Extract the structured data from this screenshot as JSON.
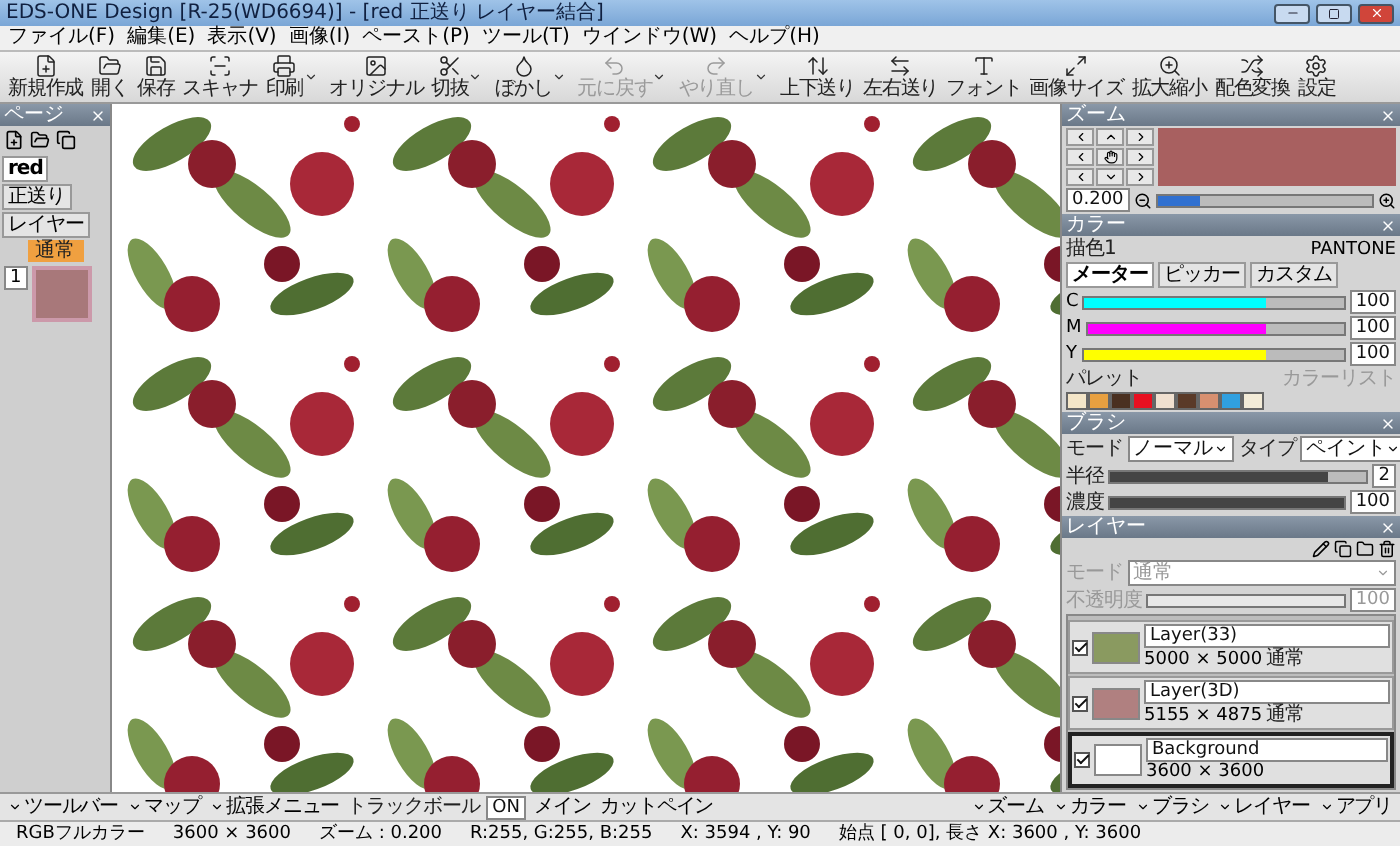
{
  "window": {
    "title": "EDS-ONE Design [R-25(WD6694)] - [red 正送り レイヤー結合]"
  },
  "menu": [
    "ファイル(F)",
    "編集(E)",
    "表示(V)",
    "画像(I)",
    "ペースト(P)",
    "ツール(T)",
    "ウインドウ(W)",
    "ヘルプ(H)"
  ],
  "toolbar": [
    {
      "label": "新規作成",
      "kind": "new",
      "disabled": false,
      "dropdown": false
    },
    {
      "label": "開く",
      "kind": "open",
      "disabled": false,
      "dropdown": false
    },
    {
      "label": "保存",
      "kind": "save",
      "disabled": false,
      "dropdown": false
    },
    {
      "label": "スキャナ",
      "kind": "scan",
      "disabled": false,
      "dropdown": false
    },
    {
      "label": "印刷",
      "kind": "print",
      "disabled": false,
      "dropdown": true
    },
    {
      "label": "オリジナル",
      "kind": "image",
      "disabled": false,
      "dropdown": false
    },
    {
      "label": "切抜",
      "kind": "cut",
      "disabled": false,
      "dropdown": true
    },
    {
      "label": "ぼかし",
      "kind": "blur",
      "disabled": false,
      "dropdown": true
    },
    {
      "label": "元に戻す",
      "kind": "undo",
      "disabled": true,
      "dropdown": true
    },
    {
      "label": "やり直し",
      "kind": "redo",
      "disabled": true,
      "dropdown": true
    },
    {
      "label": "上下送り",
      "kind": "vertical",
      "disabled": false,
      "dropdown": false
    },
    {
      "label": "左右送り",
      "kind": "horizontal",
      "disabled": false,
      "dropdown": false
    },
    {
      "label": "フォント",
      "kind": "font",
      "disabled": false,
      "dropdown": false
    },
    {
      "label": "画像サイズ",
      "kind": "size",
      "disabled": false,
      "dropdown": false
    },
    {
      "label": "拡大縮小",
      "kind": "scale",
      "disabled": false,
      "dropdown": false
    },
    {
      "label": "配色変換",
      "kind": "recolor",
      "disabled": false,
      "dropdown": false
    },
    {
      "label": "設定",
      "kind": "settings",
      "disabled": false,
      "dropdown": false
    }
  ],
  "left_panel": {
    "title": "ページ",
    "tabs": [
      {
        "label": "red",
        "selected": true
      },
      {
        "label": "正送り",
        "selected": false
      },
      {
        "label": "レイヤー",
        "selected": false
      }
    ],
    "page_label": "通常",
    "page_number": "1"
  },
  "zoom_panel": {
    "title": "ズーム",
    "value": "0.200",
    "level": 0.2
  },
  "color_panel": {
    "title": "カラー",
    "drawing_color": "描色1",
    "system": "PANTONE",
    "tabs": [
      {
        "label": "メーター",
        "selected": true
      },
      {
        "label": "ピッカー",
        "selected": false
      },
      {
        "label": "カスタム",
        "selected": false
      }
    ],
    "channels": [
      {
        "name": "C",
        "value": "100",
        "level": 0.7,
        "color": "#00ffff"
      },
      {
        "name": "M",
        "value": "100",
        "level": 0.7,
        "color": "#ff00ff"
      },
      {
        "name": "Y",
        "value": "100",
        "level": 0.7,
        "color": "#ffff00"
      }
    ],
    "palette_label": "パレット",
    "list_label": "カラーリスト",
    "swatches": [
      {
        "color": "#f5e6c8"
      },
      {
        "color": "#e8a040"
      },
      {
        "color": "#4a3020"
      },
      {
        "color": "#e81020"
      },
      {
        "color": "#f0e0d0"
      },
      {
        "color": "#5a3a28"
      },
      {
        "color": "#d89070"
      },
      {
        "color": "#30a0e0"
      },
      {
        "color": "#f4ecd8"
      }
    ]
  },
  "brush_panel": {
    "title": "ブラシ",
    "mode_label": "モード",
    "mode": "ノーマル",
    "type_label": "タイプ",
    "type": "ペイント",
    "sliders": [
      {
        "label": "半径",
        "value": "2",
        "level": 0.85
      },
      {
        "label": "濃度",
        "value": "100",
        "level": 1
      }
    ]
  },
  "layer_panel": {
    "title": "レイヤー",
    "mode_label": "モード",
    "mode": "通常",
    "opacity_label": "不透明度",
    "opacity": "100",
    "opacity_slider": {
      "level": 1
    },
    "disabled": true,
    "layers": [
      {
        "name": "Layer(33)",
        "size": "5000 × 5000",
        "mode": "通常",
        "visible": true,
        "selected": false,
        "kind": "green"
      },
      {
        "name": "Layer(3D)",
        "size": "5155 × 4875",
        "mode": "通常",
        "visible": true,
        "selected": false,
        "kind": "red"
      },
      {
        "name": "Background",
        "size": "3600 × 3600",
        "visible": true,
        "selected": true,
        "kind": "blank"
      }
    ]
  },
  "bottom_toolbar": {
    "left": [
      "ツールバー",
      "マップ",
      "拡張メニュー"
    ],
    "trackball_label": "トラックボール",
    "trackball_value": "ON",
    "main": "メイン",
    "cut": "カットペイン",
    "right": [
      "ズーム",
      "カラー",
      "ブラシ",
      "レイヤー",
      "アプリ"
    ]
  },
  "status_bar": [
    "RGBフルカラー",
    "3600 × 3600",
    "ズーム : 0.200",
    "R:255, G:255, B:255",
    "X: 3594 , Y: 90",
    "始点 [ 0, 0], 長さ X: 3600 , Y: 3600"
  ]
}
